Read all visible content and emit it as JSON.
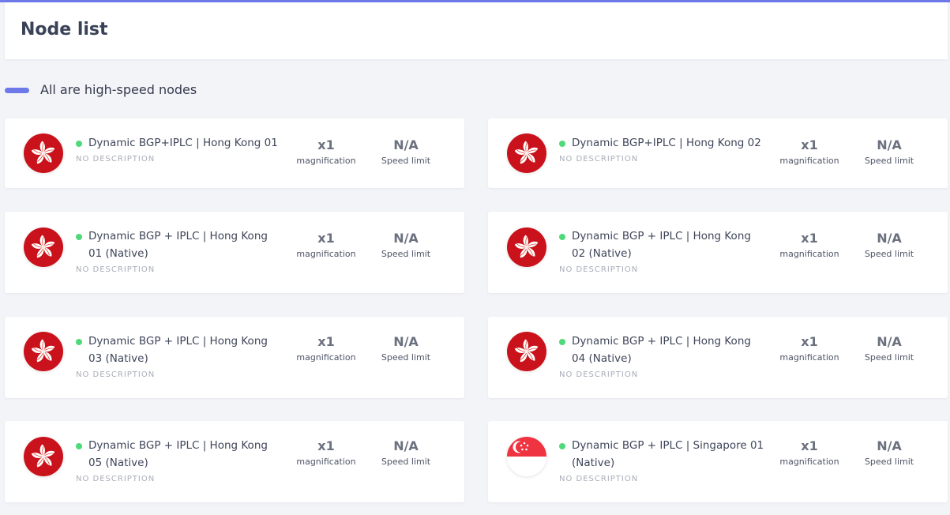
{
  "page": {
    "title": "Node list"
  },
  "section": {
    "title": "All are high-speed nodes"
  },
  "colors": {
    "accent": "#6d79e8",
    "status_online": "#4fd97a",
    "hk_red": "#de2910",
    "sg_red": "#ef3340"
  },
  "nodes": [
    {
      "name": "Dynamic BGP+IPLC | Hong Kong 01",
      "description": "NO DESCRIPTION",
      "magnification": "x1",
      "magnification_label": "magnification",
      "speed": "N/A",
      "speed_label": "Speed limit",
      "flag": "hong-kong-flag-icon"
    },
    {
      "name": "Dynamic BGP+IPLC | Hong Kong 02",
      "description": "NO DESCRIPTION",
      "magnification": "x1",
      "magnification_label": "magnification",
      "speed": "N/A",
      "speed_label": "Speed limit",
      "flag": "hong-kong-flag-icon"
    },
    {
      "name": "Dynamic BGP + IPLC | Hong Kong 01 (Native)",
      "description": "NO DESCRIPTION",
      "magnification": "x1",
      "magnification_label": "magnification",
      "speed": "N/A",
      "speed_label": "Speed limit",
      "flag": "hong-kong-flag-icon"
    },
    {
      "name": "Dynamic BGP + IPLC | Hong Kong 02 (Native)",
      "description": "NO DESCRIPTION",
      "magnification": "x1",
      "magnification_label": "magnification",
      "speed": "N/A",
      "speed_label": "Speed limit",
      "flag": "hong-kong-flag-icon"
    },
    {
      "name": "Dynamic BGP + IPLC | Hong Kong 03 (Native)",
      "description": "NO DESCRIPTION",
      "magnification": "x1",
      "magnification_label": "magnification",
      "speed": "N/A",
      "speed_label": "Speed limit",
      "flag": "hong-kong-flag-icon"
    },
    {
      "name": "Dynamic BGP + IPLC | Hong Kong 04 (Native)",
      "description": "NO DESCRIPTION",
      "magnification": "x1",
      "magnification_label": "magnification",
      "speed": "N/A",
      "speed_label": "Speed limit",
      "flag": "hong-kong-flag-icon"
    },
    {
      "name": "Dynamic BGP + IPLC | Hong Kong 05 (Native)",
      "description": "NO DESCRIPTION",
      "magnification": "x1",
      "magnification_label": "magnification",
      "speed": "N/A",
      "speed_label": "Speed limit",
      "flag": "hong-kong-flag-icon"
    },
    {
      "name": "Dynamic BGP + IPLC | Singapore 01 (Native)",
      "description": "NO DESCRIPTION",
      "magnification": "x1",
      "magnification_label": "magnification",
      "speed": "N/A",
      "speed_label": "Speed limit",
      "flag": "singapore-flag-icon"
    }
  ]
}
